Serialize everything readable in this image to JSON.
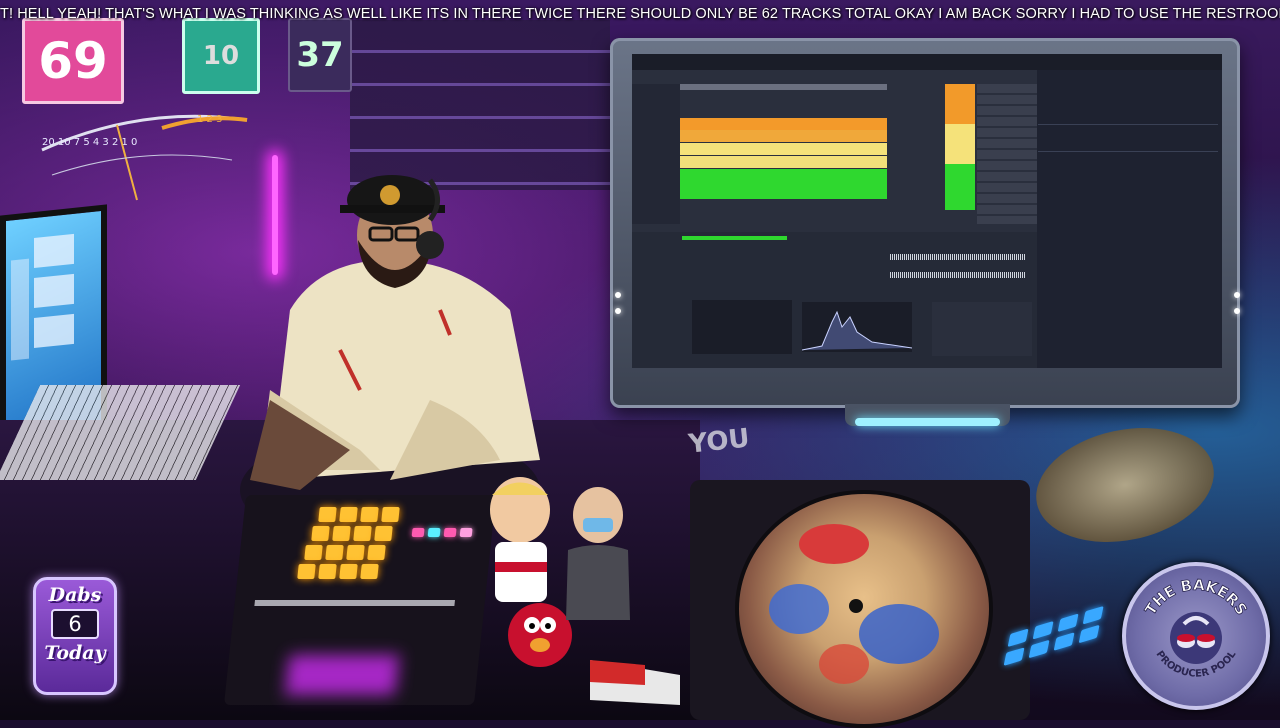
{
  "ticker": {
    "text": "T! HELL YEAH! THAT'S WHAT I WAS THINKING AS WELL LIKE ITS IN THERE TWICE THERE SHOULD ONLY BE 62 TRACKS TOTAL OKAY I AM BACK SORRY I HAD TO USE THE RESTROOM"
  },
  "wall": {
    "jersey_left": "69",
    "jersey_middle": "10",
    "jersey_right": "37",
    "vu_scale_left": "20   10  7  5 4 3 2 1  0",
    "vu_scale_right": "1   2   3"
  },
  "poster": {
    "text": "YOU"
  },
  "dabs_badge": {
    "line1": "Dabs",
    "count": "6",
    "line2": "Today"
  },
  "bakers_logo": {
    "top_text": "THE BAKERS",
    "bottom_text": "PRODUCER POOL"
  }
}
